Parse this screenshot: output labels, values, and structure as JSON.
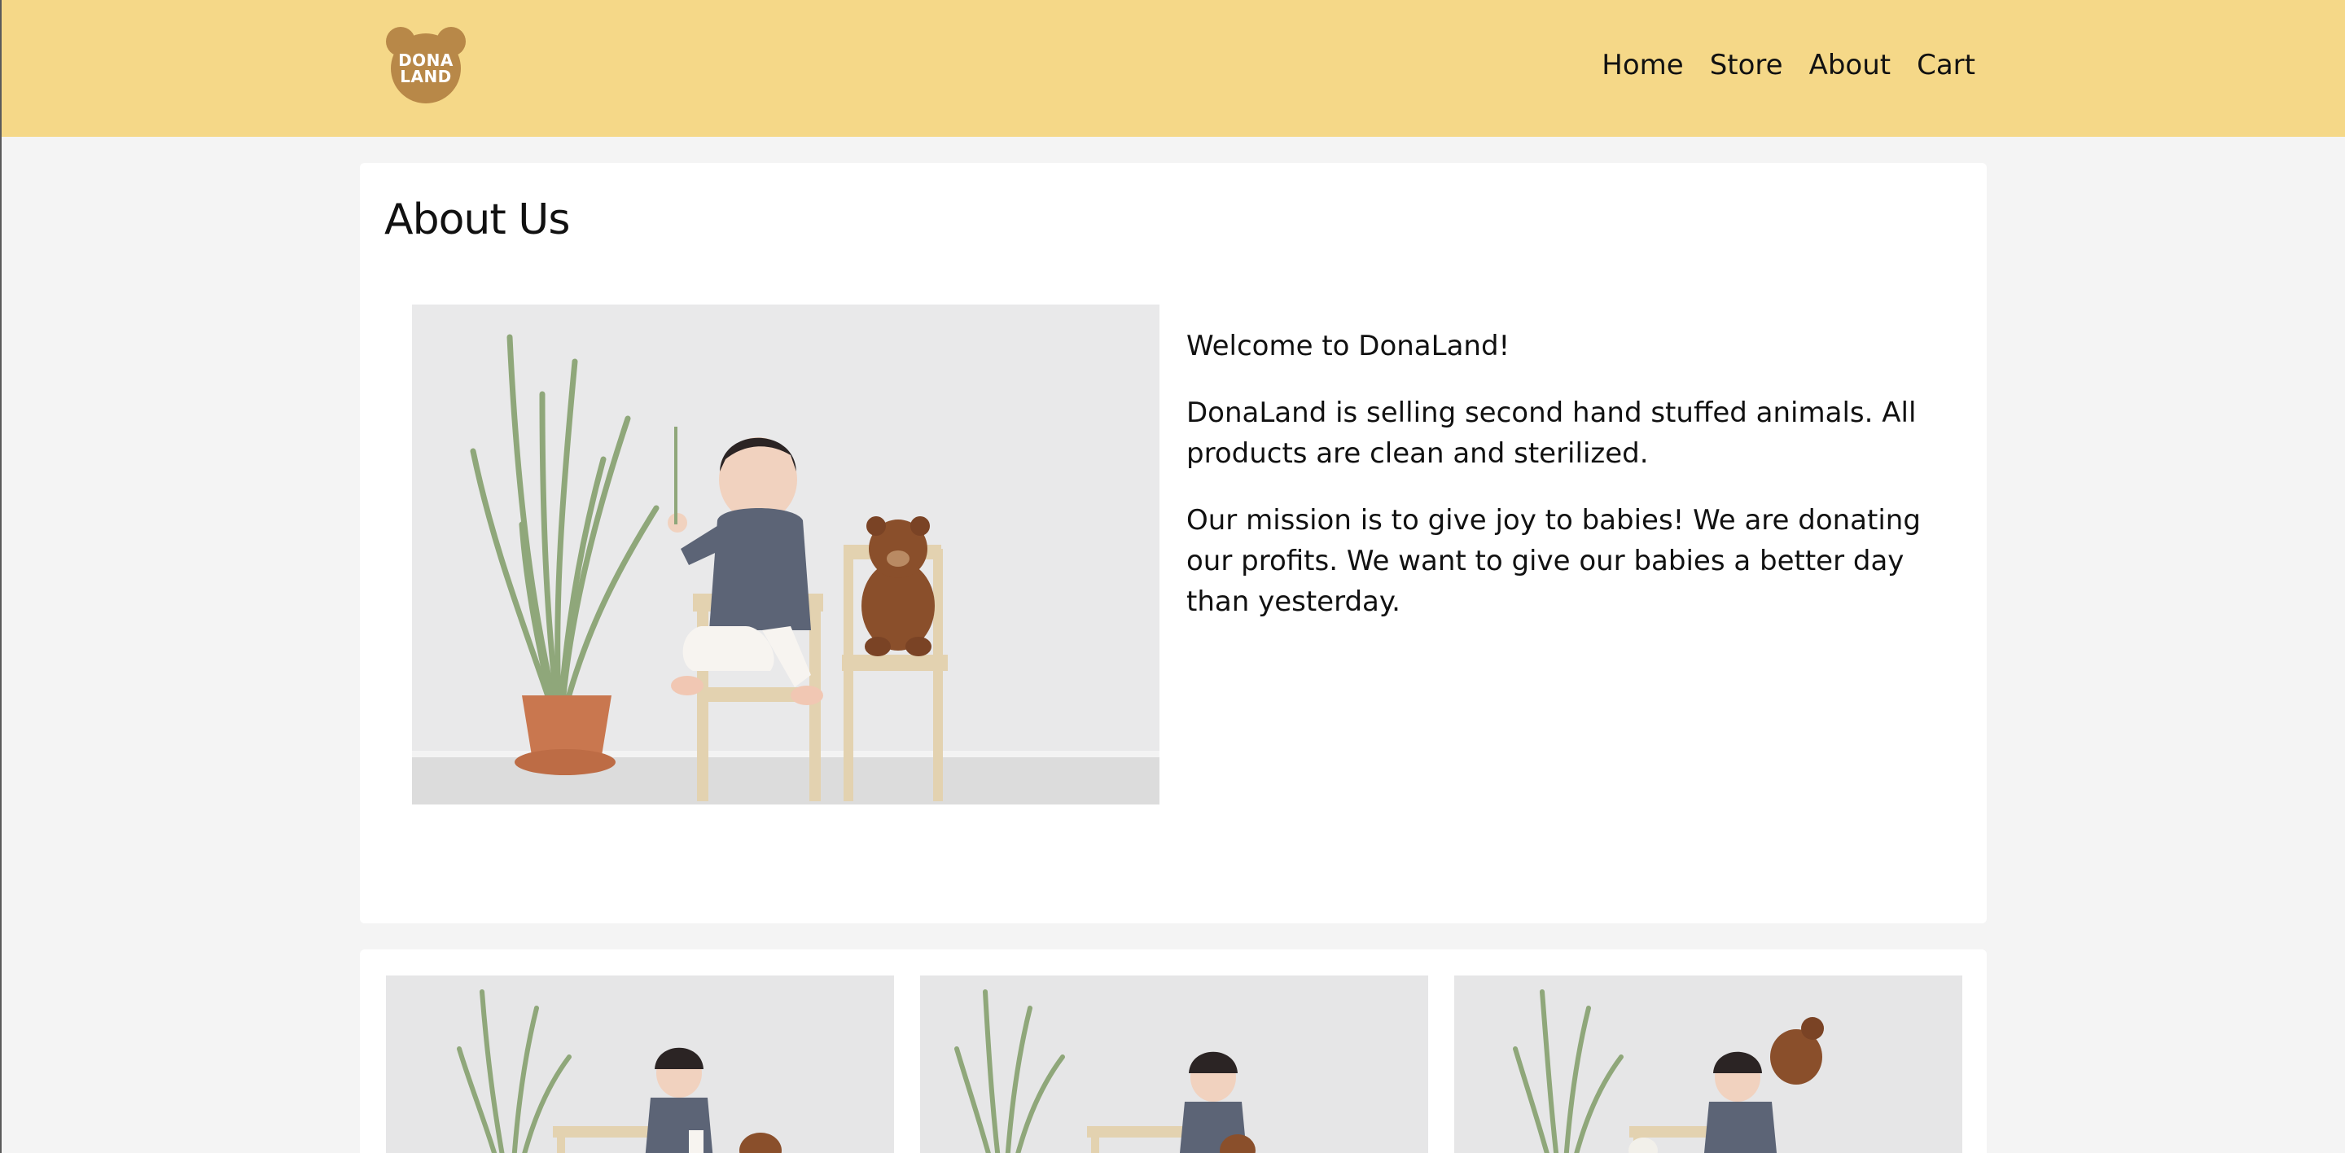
{
  "brand": {
    "logo_line1": "DONA",
    "logo_line2": "LAND",
    "bg_color": "#f5d888",
    "logo_color": "#b88848"
  },
  "nav": {
    "items": [
      "Home",
      "Store",
      "About",
      "Cart"
    ]
  },
  "about": {
    "title": "About Us",
    "paragraphs": [
      "Welcome to DonaLand!",
      "DonaLand is selling second hand stuffed animals. All products are clean and sterilized.",
      "Our mission is to give joy to babies! We are donating our profits. We want to give our babies a better day than yesterday."
    ]
  },
  "images": {
    "main": "photo-baby-plant-teddy",
    "gallery": [
      "photo-baby-plant-1",
      "photo-baby-plant-2",
      "photo-baby-plant-3"
    ]
  }
}
